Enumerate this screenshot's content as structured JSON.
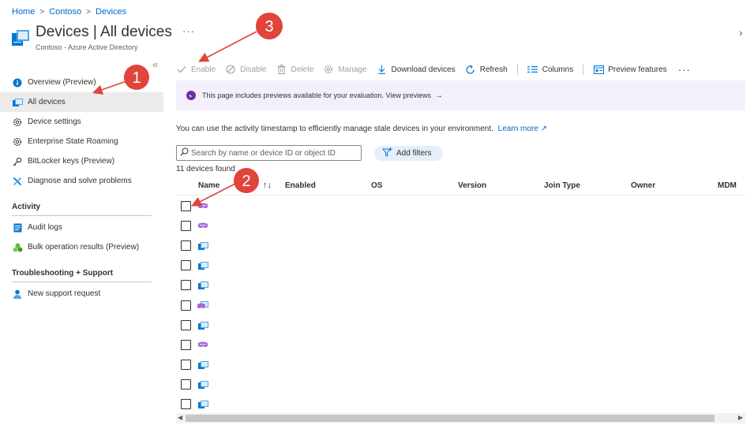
{
  "breadcrumb": [
    "Home",
    "Contoso",
    "Devices"
  ],
  "header": {
    "title": "Devices | All devices",
    "subtitle": "Contoso - Azure Active Directory",
    "more": "···"
  },
  "sidebar": {
    "collapse": "«",
    "items": [
      {
        "label": "Overview (Preview)",
        "icon": "info-icon"
      },
      {
        "label": "All devices",
        "icon": "devices-icon",
        "active": true
      },
      {
        "label": "Device settings",
        "icon": "gear-icon"
      },
      {
        "label": "Enterprise State Roaming",
        "icon": "gear-icon"
      },
      {
        "label": "BitLocker keys (Preview)",
        "icon": "key-icon"
      },
      {
        "label": "Diagnose and solve problems",
        "icon": "wrench-icon"
      }
    ],
    "sections": [
      {
        "title": "Activity",
        "items": [
          {
            "label": "Audit logs",
            "icon": "audit-log-icon"
          },
          {
            "label": "Bulk operation results (Preview)",
            "icon": "bulk-operation-icon"
          }
        ]
      },
      {
        "title": "Troubleshooting + Support",
        "items": [
          {
            "label": "New support request",
            "icon": "support-person-icon"
          }
        ]
      }
    ]
  },
  "toolbar": {
    "enable": "Enable",
    "disable": "Disable",
    "delete": "Delete",
    "manage": "Manage",
    "download": "Download devices",
    "refresh": "Refresh",
    "columns": "Columns",
    "preview_features": "Preview features",
    "more": "···"
  },
  "banner": {
    "text": "This page includes previews available for your evaluation. View previews",
    "arrow": "→"
  },
  "info": {
    "text": "You can use the activity timestamp to efficiently manage stale devices in your environment.",
    "learn_more": "Learn more"
  },
  "search": {
    "placeholder": "Search by name or device ID or object ID"
  },
  "filters": {
    "label": "Add filters"
  },
  "table": {
    "count": "11 devices found",
    "columns": [
      "Name",
      "Enabled",
      "OS",
      "Version",
      "Join Type",
      "Owner",
      "MDM"
    ],
    "sort_icon": "↑↓",
    "rows": [
      {
        "icon": "hololens-icon"
      },
      {
        "icon": "hololens-icon"
      },
      {
        "icon": "desktop-icon"
      },
      {
        "icon": "desktop-icon"
      },
      {
        "icon": "desktop-icon"
      },
      {
        "icon": "mixed-device-icon"
      },
      {
        "icon": "desktop-icon"
      },
      {
        "icon": "hololens-icon"
      },
      {
        "icon": "desktop-icon"
      },
      {
        "icon": "desktop-icon"
      },
      {
        "icon": "desktop-icon"
      }
    ]
  },
  "annotations": [
    {
      "label": "1"
    },
    {
      "label": "2"
    },
    {
      "label": "3"
    }
  ],
  "colors": {
    "link": "#0066cc",
    "accent": "#0078d4",
    "banner_bg": "#f4f0fb",
    "annotation": "#e0443a"
  }
}
